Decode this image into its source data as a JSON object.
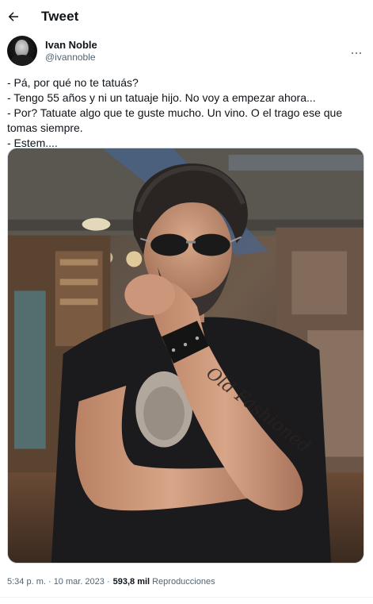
{
  "header": {
    "title": "Tweet",
    "back_icon": "arrow-left-icon"
  },
  "author": {
    "name": "Ivan Noble",
    "handle": "@ivannoble",
    "more_icon": "more-horizontal-icon"
  },
  "tweet": {
    "lines": [
      "- Pá, por qué no te tatuás?",
      "- Tengo 55 años y ni un tatuaje hijo. No voy a empezar ahora...",
      "- Por? Tatuate algo que te guste mucho. Un vino. O el trago ese que tomas siempre.",
      "- Estem...."
    ],
    "photo_tattoo_text": "Old Fashioned"
  },
  "meta": {
    "timestamp": "5:34 p. m. · 10 mar. 2023 ·",
    "views_count": "593,8 mil",
    "views_label": "Reproducciones"
  },
  "colors": {
    "text": "#0f1419",
    "secondary": "#536471",
    "border": "#cfd9de"
  }
}
